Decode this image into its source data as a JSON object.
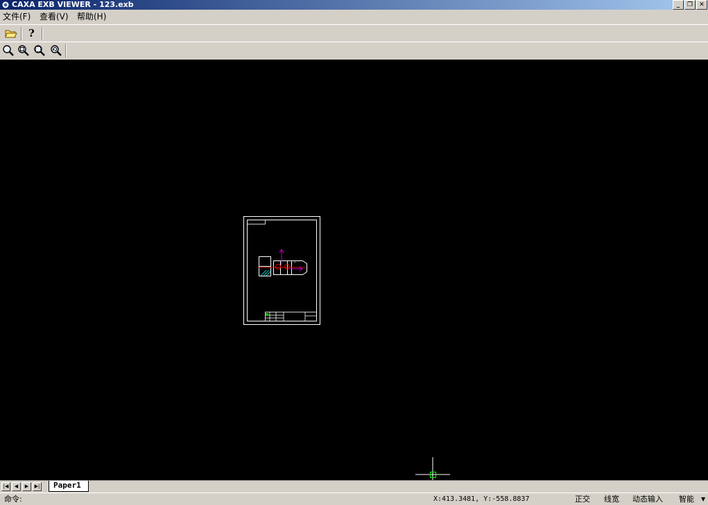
{
  "window": {
    "title": "CAXA EXB VIEWER - 123.exb",
    "minimize": "_",
    "restore": "❐",
    "close": "✕"
  },
  "menu": [
    {
      "label": "文件(F)"
    },
    {
      "label": "查看(V)"
    },
    {
      "label": "帮助(H)"
    }
  ],
  "toolbar": {
    "icons": [
      "open-folder-icon",
      "help-icon"
    ]
  },
  "zoom_toolbar": {
    "icons": [
      "zoom-icon",
      "zoom-window-icon",
      "zoom-all-icon",
      "zoom-previous-icon"
    ]
  },
  "tabs": {
    "items": [
      "Paper1"
    ]
  },
  "status": {
    "command_label": "命令:",
    "coordinates": "X:413.3481, Y:-558.8837",
    "ortho": "正交",
    "line_width": "线宽",
    "dynamic_input": "动态输入",
    "snap_mode": "智能"
  },
  "colors": {
    "canvas": "#000000",
    "drawing_lines": "#ffffff",
    "dimension": "#c000c0",
    "cursor": "#ffffff",
    "cursor_box": "#00ff00",
    "titlebar_start": "#0a246a",
    "titlebar_end": "#a6caf0"
  }
}
